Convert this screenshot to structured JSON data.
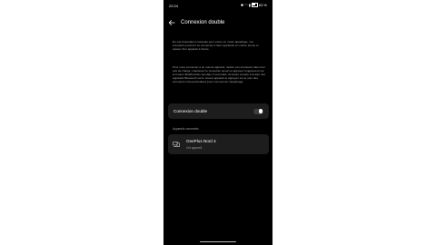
{
  "status_bar": {
    "time": "22:24",
    "icons": [
      "bluetooth-icon",
      "wifi-icon",
      "signal-icon",
      "battery-icon"
    ],
    "battery_text": "63 %"
  },
  "header": {
    "title": "Connexion double",
    "back_icon": "back-arrow-icon"
  },
  "description": {
    "paragraph1": "En cas d'opération manuelle pour entrer en mode appairage, vos écouteurs pourront se connecter à deux appareils en même temps et passer d'un appareil à l'autre.",
    "paragraph2": "Pour vous connecter à un nouvel appareil, mettez vos écouteurs dans leur étui de charge, maintenez le couvercle ouvert et appuyez longuement sur le bouton Multifonction pendant 2 secondes. Accédez ensuite à la liste des appareils Bluetooth sur le nouvel appareil et appuyez sur le nom des écouteurs intra-auriculaires pour commencer l'appairage."
  },
  "toggle": {
    "label": "Connexion double",
    "enabled": false
  },
  "connected_devices": {
    "section_label": "Appareils connectés",
    "devices": [
      {
        "name": "OnePlus Nord 4",
        "status": "Cet appareil",
        "icon": "devices-icon"
      }
    ]
  },
  "colors": {
    "background": "#000000",
    "card": "#1d1d1d",
    "text_primary": "#ffffff",
    "text_secondary": "#a8a8a8"
  }
}
